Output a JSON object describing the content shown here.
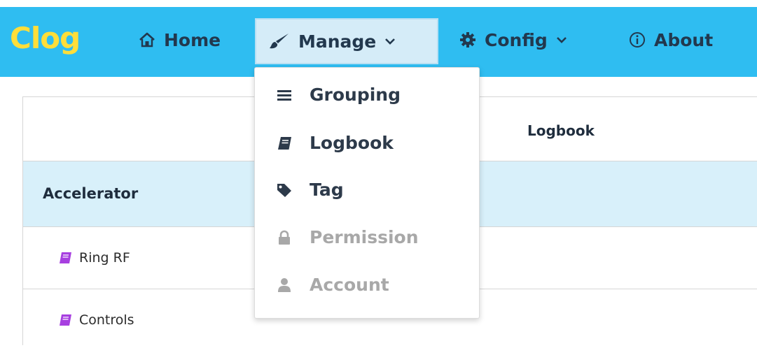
{
  "brand": {
    "name": "Clog",
    "color": "#ffde3a"
  },
  "navbar": {
    "background": "#2fbdf1",
    "items": [
      {
        "label": "Home",
        "icon": "home-icon"
      },
      {
        "label": "Manage",
        "icon": "brush-icon",
        "has_dropdown": true,
        "open": true
      },
      {
        "label": "Config",
        "icon": "gear-icon",
        "has_dropdown": true
      },
      {
        "label": "About",
        "icon": "info-icon"
      }
    ]
  },
  "manage_menu": {
    "items": [
      {
        "label": "Grouping",
        "icon": "bars-icon",
        "enabled": true
      },
      {
        "label": "Logbook",
        "icon": "book-icon",
        "enabled": true
      },
      {
        "label": "Tag",
        "icon": "tag-icon",
        "enabled": true
      },
      {
        "label": "Permission",
        "icon": "lock-icon",
        "enabled": false
      },
      {
        "label": "Account",
        "icon": "user-icon",
        "enabled": false
      }
    ]
  },
  "table": {
    "column_header": "Logbook",
    "group": {
      "name": "Accelerator",
      "background": "#d8f0fa"
    },
    "rows": [
      {
        "name": "Ring RF",
        "icon": "book-icon",
        "icon_color": "#a73fe0"
      },
      {
        "name": "Controls",
        "icon": "book-icon",
        "icon_color": "#a73fe0"
      }
    ]
  }
}
